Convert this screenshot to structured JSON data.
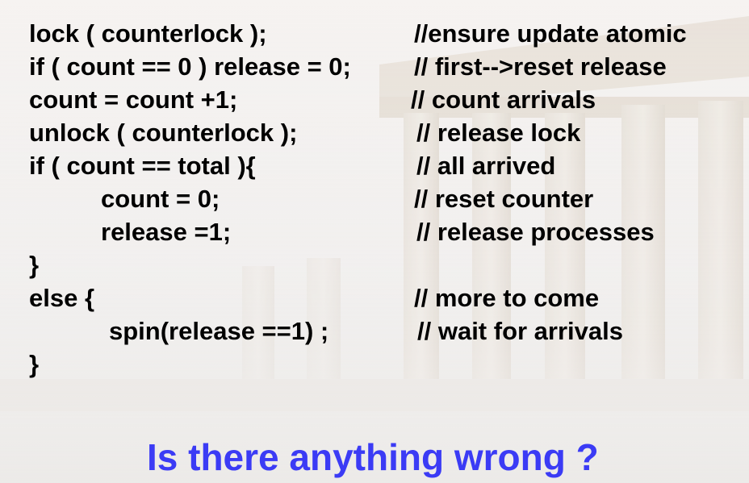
{
  "slide": {
    "code_lines": [
      "lock ( counterlock );",
      "if ( count == 0 ) release = 0;",
      "count = count +1;",
      "unlock ( counterlock );",
      "if ( count == total ){",
      "count = 0;",
      "release =1;",
      "}",
      "else {",
      "spin(release ==1) ;",
      "}"
    ],
    "comment_lines": [
      "//ensure update atomic",
      "// first-->reset release",
      "// count arrivals",
      "// release lock",
      "// all arrived",
      "// reset counter",
      "// release processes",
      "// more to come",
      "// wait for arrivals"
    ],
    "question": "Is there anything wrong ?"
  },
  "colors": {
    "text": "#000000",
    "question": "#3b3bf5",
    "background": "#f4f3f2"
  }
}
